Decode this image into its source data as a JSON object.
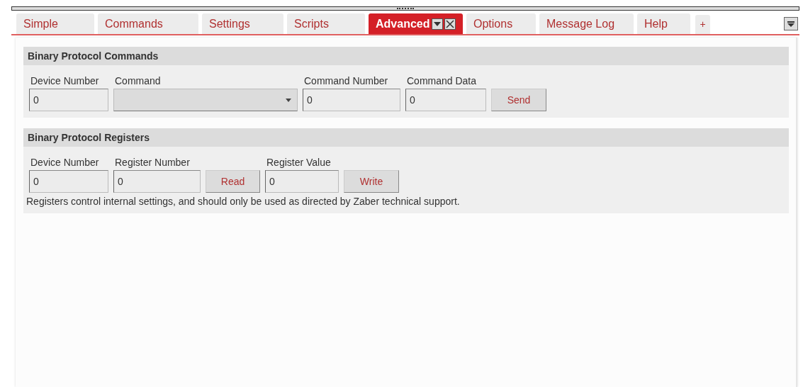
{
  "tabs": [
    {
      "label": "Simple",
      "selected": false
    },
    {
      "label": "Commands",
      "selected": false
    },
    {
      "label": "Settings",
      "selected": false
    },
    {
      "label": "Scripts",
      "selected": false
    },
    {
      "label": "Advanced",
      "selected": true
    },
    {
      "label": "Options",
      "selected": false
    },
    {
      "label": "Message Log",
      "selected": false
    },
    {
      "label": "Help",
      "selected": false
    }
  ],
  "add_tab": "+",
  "sections": [
    {
      "title": "Binary Protocol Commands",
      "controls": [
        {
          "kind": "input",
          "label": "Device Number",
          "value": "0"
        },
        {
          "kind": "dropdown",
          "label": "Command"
        },
        {
          "kind": "input",
          "label": "Command Number",
          "value": "0"
        },
        {
          "kind": "input",
          "label": "Command Data",
          "value": "0"
        },
        {
          "kind": "button",
          "label": "Send"
        }
      ]
    },
    {
      "title": "Binary Protocol Registers",
      "controls": [
        {
          "kind": "input",
          "label": "Device Number",
          "value": "0"
        },
        {
          "kind": "input",
          "label": "Register Number",
          "value": "0"
        },
        {
          "kind": "button",
          "label": "Read"
        },
        {
          "kind": "input",
          "label": "Register Value",
          "value": "0"
        },
        {
          "kind": "button",
          "label": "Write"
        }
      ],
      "note": "Registers control internal settings, and should only be used as directed by Zaber technical support."
    }
  ]
}
